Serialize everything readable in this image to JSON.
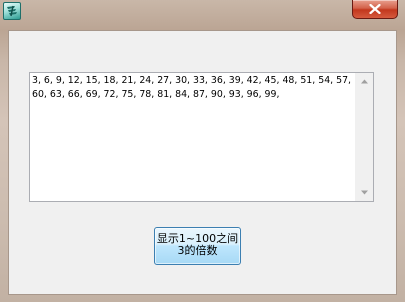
{
  "window": {
    "close_icon": "close-icon",
    "app_icon": "app-icon"
  },
  "output": {
    "text": "3, 6, 9, 12, 15, 18, 21, 24, 27, 30, 33, 36, 39, 42, 45, 48, 51, 54, 57, 60, 63, 66, 69, 72, 75, 78, 81, 84, 87, 90, 93, 96, 99,"
  },
  "action_button": {
    "line1": "显示1~100之间",
    "line2": "3的倍数"
  },
  "colors": {
    "close_button": "#c2371d",
    "client_background": "#f0f0f0",
    "button_border": "#3c7fb1",
    "button_fill": "#bee6fd"
  }
}
